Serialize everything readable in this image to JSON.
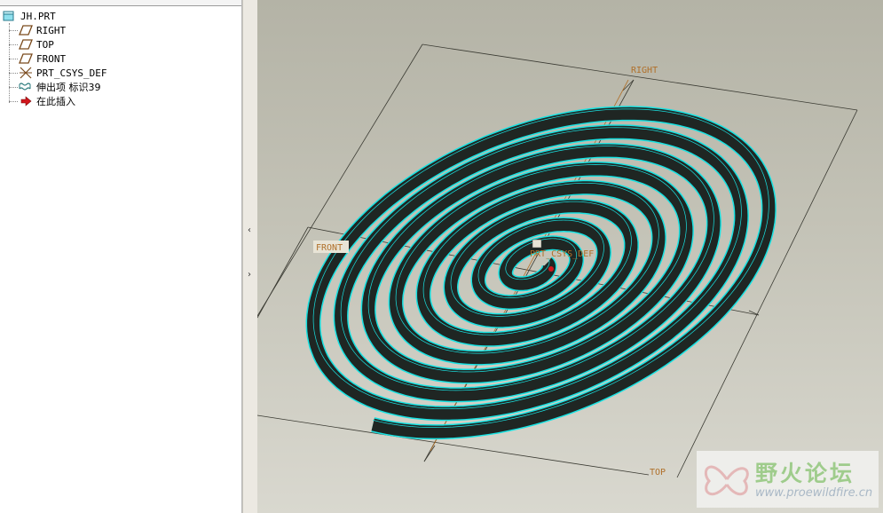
{
  "model_tree": {
    "root": "JH.PRT",
    "items": [
      {
        "label": "RIGHT",
        "icon": "datum-plane-icon"
      },
      {
        "label": "TOP",
        "icon": "datum-plane-icon"
      },
      {
        "label": "FRONT",
        "icon": "datum-plane-icon"
      },
      {
        "label": "PRT_CSYS_DEF",
        "icon": "coordinate-system-icon"
      },
      {
        "label": "伸出项 标识39",
        "icon": "extrude-feature-icon"
      },
      {
        "label": "在此插入",
        "icon": "insert-here-arrow-icon"
      }
    ]
  },
  "splitter": {
    "collapse_glyph": "‹",
    "expand_glyph": "›"
  },
  "viewport": {
    "datum_labels": {
      "right": "RIGHT",
      "top": "TOP",
      "front": "FRONT",
      "csys": "PRT_CSYS_DEF"
    },
    "colors": {
      "spiral_fill": "#1f2623",
      "spiral_edge": "#18e2e2",
      "datum_line": "#3a3a32",
      "datum_label": "#b0702a"
    }
  },
  "watermark": {
    "title": "野火论坛",
    "url": "www.proewildfire.cn"
  }
}
